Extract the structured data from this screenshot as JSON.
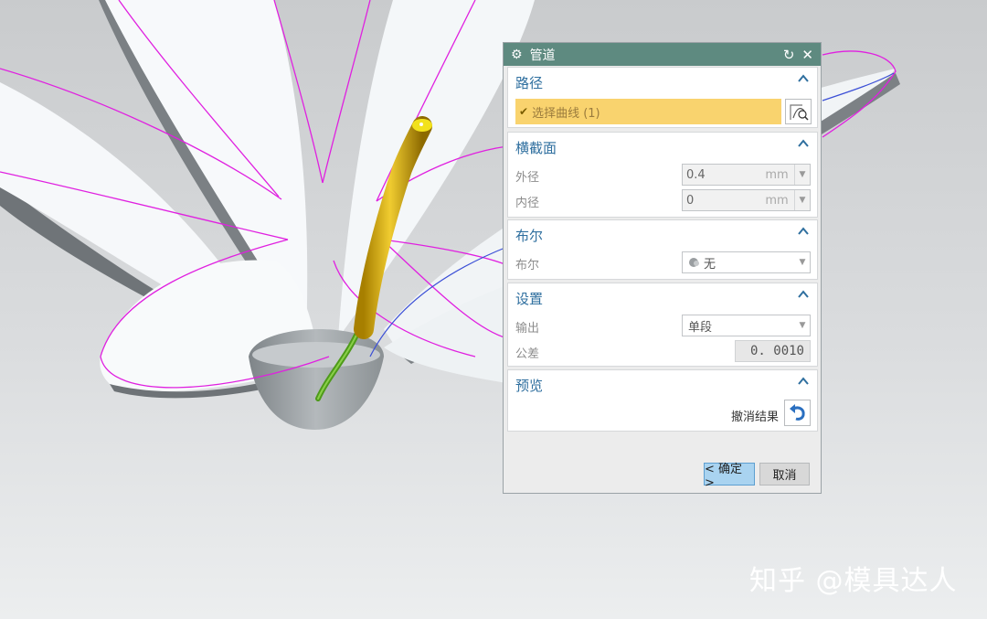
{
  "dialog": {
    "title": "管道",
    "sections": {
      "path": {
        "title": "路径",
        "select_curve_label": "选择曲线 (1)"
      },
      "cross_section": {
        "title": "横截面",
        "outer_label": "外径",
        "outer_value": "0.4",
        "outer_unit": "mm",
        "inner_label": "内径",
        "inner_value": "0",
        "inner_unit": "mm"
      },
      "boolean": {
        "title": "布尔",
        "label": "布尔",
        "value": "无"
      },
      "settings": {
        "title": "设置",
        "output_label": "输出",
        "output_value": "单段",
        "tolerance_label": "公差",
        "tolerance_value": "0. 0010"
      },
      "preview": {
        "title": "预览",
        "undo_label": "撤消结果"
      }
    },
    "ok_label": "< 确定 >",
    "cancel_label": "取消"
  },
  "watermark": "知乎 @模具达人",
  "colors": {
    "titlebar": "#5e8a80",
    "section_title": "#2f6f9f",
    "selection_highlight": "#f9d36e",
    "curve_magenta": "#e020e0",
    "tube_yellow": "#d9b000"
  }
}
